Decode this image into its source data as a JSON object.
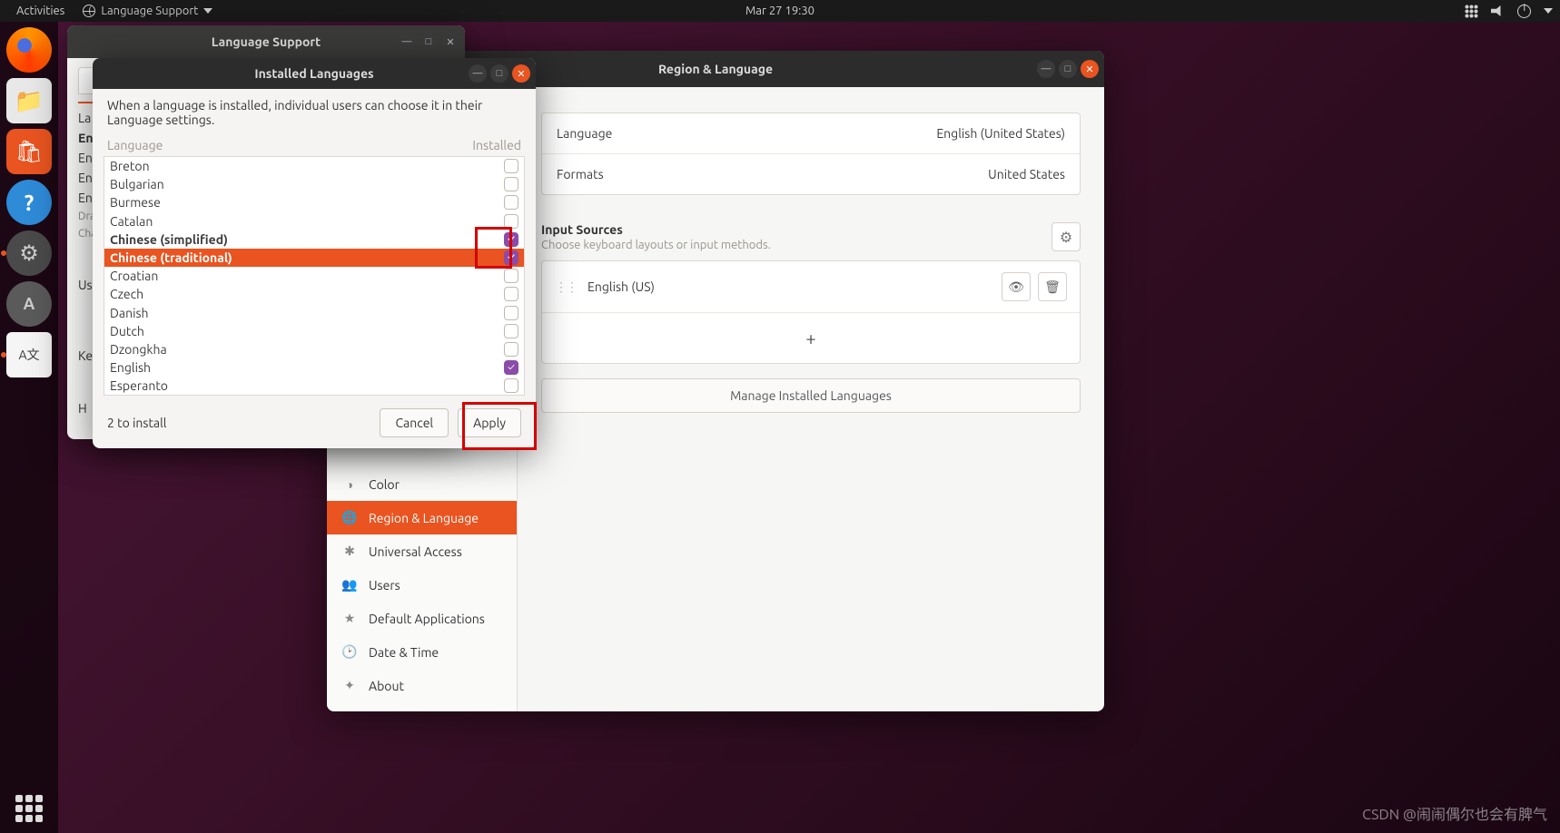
{
  "panel": {
    "activities": "Activities",
    "app_menu": "Language Support",
    "clock": "Mar 27  19:30"
  },
  "dock": {
    "firefox": "Firefox",
    "files": "Files",
    "software": "Ubuntu Software",
    "help": "Help",
    "settings": "Settings",
    "updater": "Software Updater",
    "lang": "Language Support",
    "apps": "Show Applications"
  },
  "lang_support": {
    "title": "Language Support",
    "tab": "L",
    "label_lang": "La",
    "en1": "En",
    "en2": "En",
    "en3": "En",
    "en4": "En",
    "drag": "Dra",
    "changes": "Cha",
    "used": "Use",
    "key": "Key",
    "help": "H"
  },
  "settings": {
    "title": "Region & Language",
    "side": {
      "color": "Color",
      "region": "Region & Language",
      "ua": "Universal Access",
      "users": "Users",
      "defapp": "Default Applications",
      "datetime": "Date & Time",
      "about": "About"
    },
    "kv": {
      "lang_k": "Language",
      "lang_v": "English (United States)",
      "fmt_k": "Formats",
      "fmt_v": "United States"
    },
    "input": {
      "hdr": "Input Sources",
      "sub": "Choose keyboard layouts or input methods.",
      "item": "English (US)",
      "add": "+",
      "manage": "Manage Installed Languages"
    }
  },
  "installed": {
    "title": "Installed Languages",
    "note": "When a language is installed, individual users can choose it in their Language settings.",
    "col_lang": "Language",
    "col_inst": "Installed",
    "rows": [
      {
        "name": "Breton",
        "checked": false,
        "sel": false,
        "bold": false
      },
      {
        "name": "Bulgarian",
        "checked": false,
        "sel": false,
        "bold": false
      },
      {
        "name": "Burmese",
        "checked": false,
        "sel": false,
        "bold": false
      },
      {
        "name": "Catalan",
        "checked": false,
        "sel": false,
        "bold": false
      },
      {
        "name": "Chinese (simplified)",
        "checked": true,
        "sel": false,
        "bold": true
      },
      {
        "name": "Chinese (traditional)",
        "checked": true,
        "sel": true,
        "bold": true
      },
      {
        "name": "Croatian",
        "checked": false,
        "sel": false,
        "bold": false
      },
      {
        "name": "Czech",
        "checked": false,
        "sel": false,
        "bold": false
      },
      {
        "name": "Danish",
        "checked": false,
        "sel": false,
        "bold": false
      },
      {
        "name": "Dutch",
        "checked": false,
        "sel": false,
        "bold": false
      },
      {
        "name": "Dzongkha",
        "checked": false,
        "sel": false,
        "bold": false
      },
      {
        "name": "English",
        "checked": true,
        "sel": false,
        "bold": false
      },
      {
        "name": "Esperanto",
        "checked": false,
        "sel": false,
        "bold": false
      }
    ],
    "status": "2 to install",
    "cancel": "Cancel",
    "apply": "Apply"
  },
  "watermark": "CSDN @闹闹偶尔也会有脾气"
}
